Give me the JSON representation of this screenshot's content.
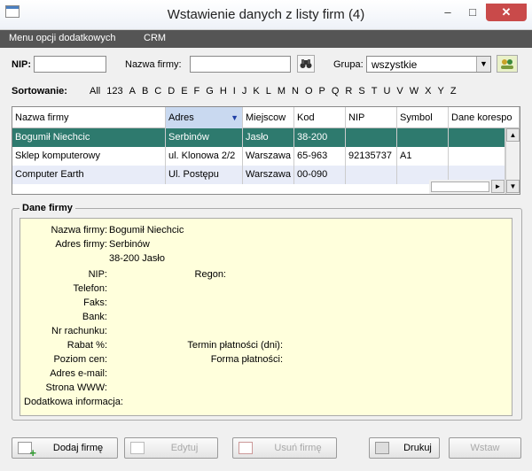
{
  "window": {
    "title": "Wstawienie danych z listy firm (4)",
    "minimize": "–",
    "maximize": "□",
    "close": "✕"
  },
  "menu": {
    "items": [
      "Menu opcji dodatkowych",
      "CRM"
    ]
  },
  "search": {
    "nip_label": "NIP:",
    "nip_value": "",
    "name_label": "Nazwa firmy:",
    "name_value": "",
    "group_label": "Grupa:",
    "group_value": "wszystkie"
  },
  "sort": {
    "label": "Sortowanie:",
    "letters": [
      "All",
      "123",
      "A",
      "B",
      "C",
      "D",
      "E",
      "F",
      "G",
      "H",
      "I",
      "J",
      "K",
      "L",
      "M",
      "N",
      "O",
      "P",
      "Q",
      "R",
      "S",
      "T",
      "U",
      "V",
      "W",
      "X",
      "Y",
      "Z"
    ]
  },
  "table": {
    "columns": [
      "Nazwa firmy",
      "Adres",
      "Miejscow",
      "Kod",
      "NIP",
      "Symbol",
      "Dane korespo"
    ],
    "sorted_column": "Adres",
    "rows": [
      [
        "Bogumił Niechcic",
        "Serbinów",
        "Jasło",
        "38-200",
        "",
        "",
        ""
      ],
      [
        "Sklep komputerowy",
        "ul. Klonowa 2/2",
        "Warszawa",
        "65-963",
        "92135737",
        "A1",
        ""
      ],
      [
        "Computer Earth",
        "Ul. Postępu",
        "Warszawa",
        "00-090",
        "",
        "",
        ""
      ]
    ],
    "selected_row": 0
  },
  "details": {
    "title": "Dane firmy",
    "fields": {
      "name_label": "Nazwa firmy:",
      "name_value": "Bogumił Niechcic",
      "address_label": "Adres firmy:",
      "address_line1": "Serbinów",
      "address_line2": "38-200 Jasło",
      "nip_label": "NIP:",
      "regon_label": "Regon:",
      "phone_label": "Telefon:",
      "fax_label": "Faks:",
      "bank_label": "Bank:",
      "account_label": "Nr rachunku:",
      "discount_label": "Rabat %:",
      "payment_term_label": "Termin płatności (dni):",
      "price_level_label": "Poziom cen:",
      "payment_form_label": "Forma płatności:",
      "email_label": "Adres e-mail:",
      "www_label": "Strona WWW:",
      "extra_label": "Dodatkowa informacja:"
    }
  },
  "buttons": {
    "add": "Dodaj firmę",
    "edit": "Edytuj",
    "delete": "Usuń firmę",
    "print": "Drukuj",
    "insert": "Wstaw"
  },
  "colors": {
    "selection": "#2e7a6e",
    "menubar": "#555555",
    "details_bg": "#ffffdc"
  }
}
